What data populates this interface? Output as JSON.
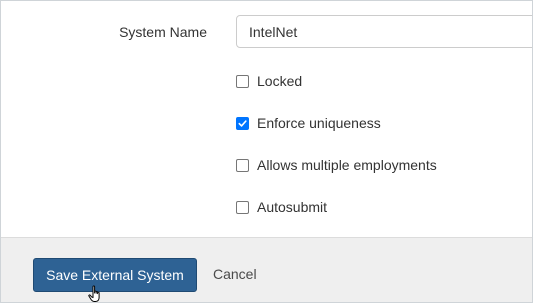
{
  "form": {
    "system_name_label": "System Name",
    "system_name_value": "IntelNet",
    "checkboxes": [
      {
        "label": "Locked",
        "checked": false
      },
      {
        "label": "Enforce uniqueness",
        "checked": true
      },
      {
        "label": "Allows multiple employments",
        "checked": false
      },
      {
        "label": "Autosubmit",
        "checked": false
      }
    ]
  },
  "footer": {
    "save_label": "Save External System",
    "cancel_label": "Cancel"
  },
  "colors": {
    "primary_button": "#2e6294",
    "checkbox_checked": "#0075ff",
    "footer_background": "#efefef"
  },
  "icons": {
    "cursor": "hand-pointer-icon",
    "check": "checkmark-icon"
  }
}
